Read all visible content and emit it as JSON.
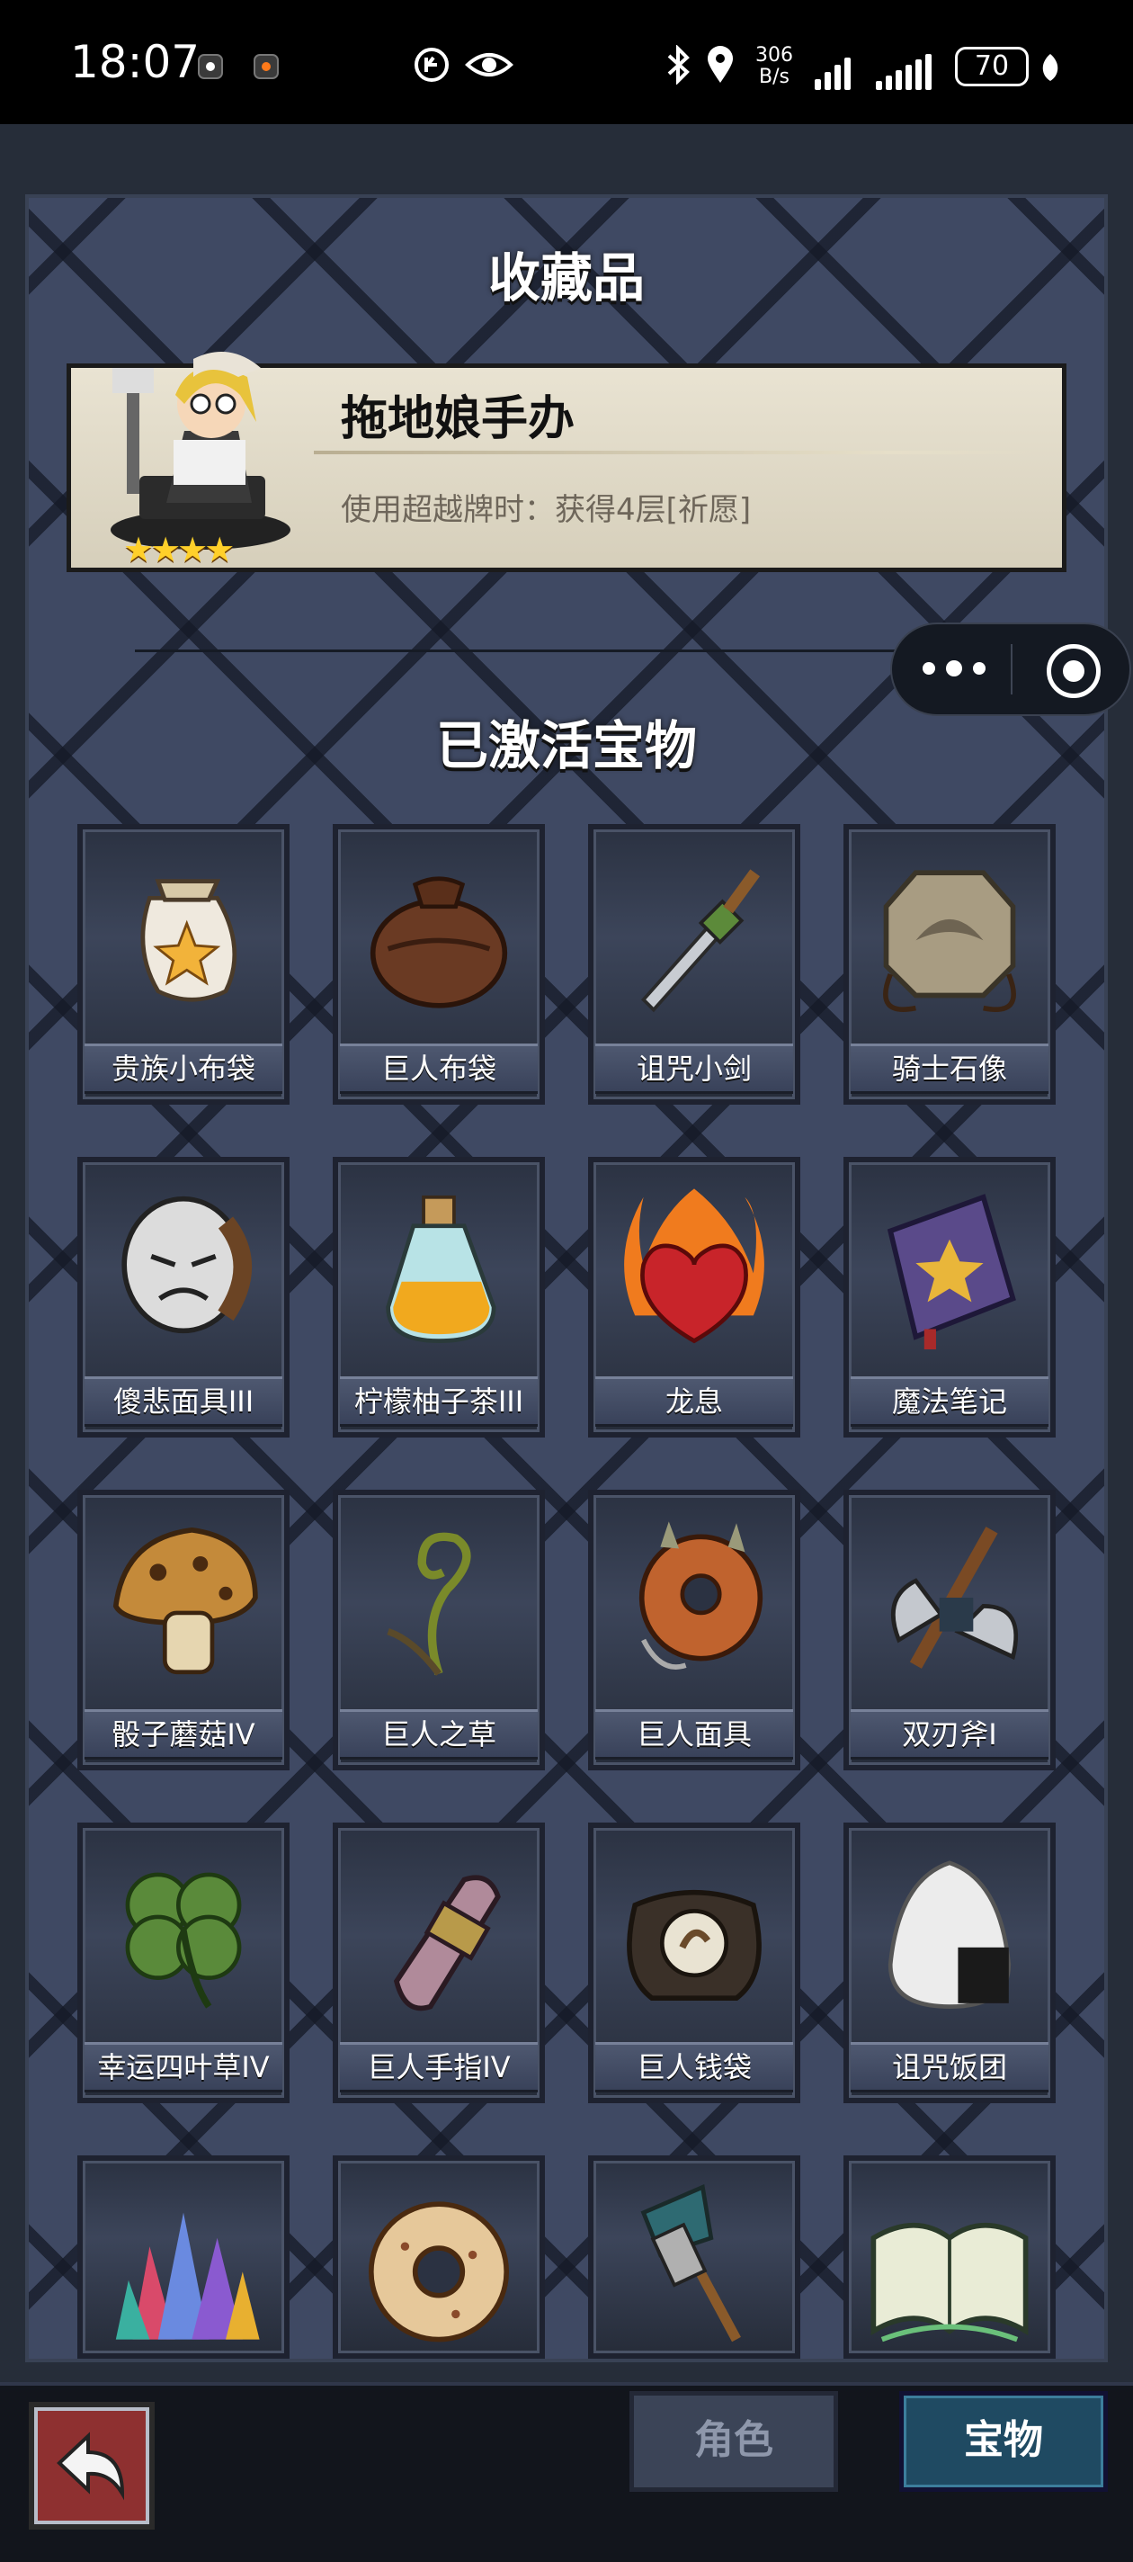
{
  "status_bar": {
    "time": "18:07",
    "net_speed_value": "306",
    "net_speed_unit": "B/s",
    "battery": "70"
  },
  "headings": {
    "collection": "收藏品",
    "activated": "已激活宝物"
  },
  "collection": {
    "name": "拖地娘手办",
    "desc": "使用超越牌时：获得4层[祈愿]",
    "stars": "★★★★",
    "rating": 4
  },
  "treasures": [
    {
      "label": "贵族小布袋",
      "icon": "star-bag-icon"
    },
    {
      "label": "巨人布袋",
      "icon": "leather-sack-icon"
    },
    {
      "label": "诅咒小剑",
      "icon": "dagger-icon"
    },
    {
      "label": "骑士石像",
      "icon": "stone-tablet-icon"
    },
    {
      "label": "傻悲面具III",
      "icon": "sad-mask-icon"
    },
    {
      "label": "柠檬柚子茶III",
      "icon": "potion-bottle-icon"
    },
    {
      "label": "龙息",
      "icon": "flaming-heart-icon"
    },
    {
      "label": "魔法笔记",
      "icon": "spellbook-icon"
    },
    {
      "label": "骰子蘑菇IV",
      "icon": "mushroom-icon"
    },
    {
      "label": "巨人之草",
      "icon": "fern-sprout-icon"
    },
    {
      "label": "巨人面具",
      "icon": "spiked-mask-icon"
    },
    {
      "label": "双刃斧I",
      "icon": "double-axe-icon"
    },
    {
      "label": "幸运四叶草IV",
      "icon": "four-leaf-clover-icon"
    },
    {
      "label": "巨人手指IV",
      "icon": "giant-finger-icon"
    },
    {
      "label": "巨人钱袋",
      "icon": "coin-pouch-icon"
    },
    {
      "label": "诅咒饭团",
      "icon": "rice-ball-icon"
    },
    {
      "label": "",
      "icon": "crystal-cluster-icon"
    },
    {
      "label": "",
      "icon": "donut-icon"
    },
    {
      "label": "",
      "icon": "torch-icon"
    },
    {
      "label": "",
      "icon": "open-book-icon"
    }
  ],
  "tabs": {
    "role": "角色",
    "treasure": "宝物"
  },
  "colors": {
    "panel": "#3f4963",
    "active_tab": "#1f4a62",
    "back_button": "#8e3030"
  }
}
